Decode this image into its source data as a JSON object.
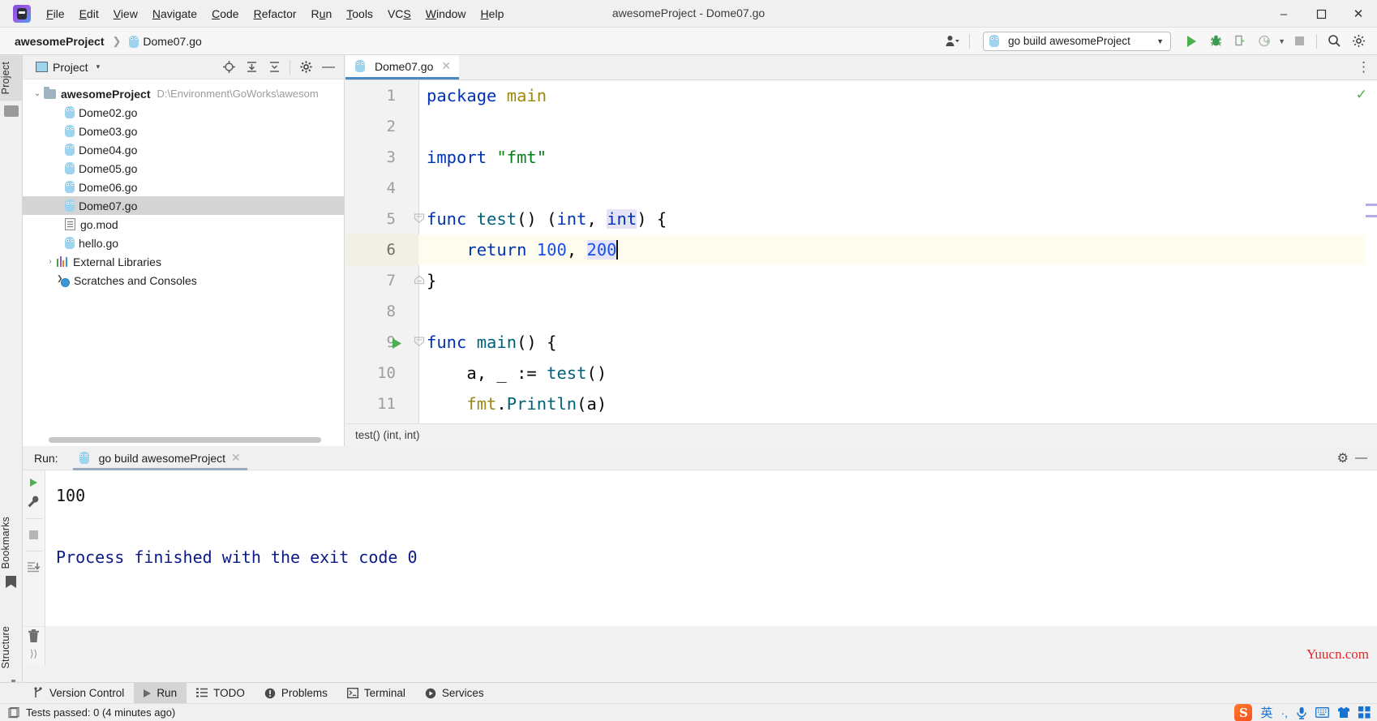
{
  "window": {
    "title": "awesomeProject - Dome07.go",
    "minimize_label": "–",
    "maximize_label": "❐",
    "close_label": "✕"
  },
  "menu": {
    "items": [
      "File",
      "Edit",
      "View",
      "Navigate",
      "Code",
      "Refactor",
      "Run",
      "Tools",
      "VCS",
      "Window",
      "Help"
    ]
  },
  "navbar": {
    "breadcrumb": {
      "project": "awesomeProject",
      "separator": "❯",
      "file": "Dome07.go"
    },
    "run_config": "go build awesomeProject",
    "run_config_caret": "▼",
    "user_caret": "▾",
    "search_icon": "⚲",
    "settings_icon": "⚙",
    "more_icon": "⋮"
  },
  "left_strip": {
    "project_tab": "Project",
    "bookmarks_tab": "Bookmarks",
    "structure_tab": "Structure"
  },
  "project_pane": {
    "title": "Project",
    "title_caret": "▾",
    "action_icons": [
      "locate-icon",
      "expand-all-icon",
      "collapse-all-icon",
      "settings-icon",
      "hide-icon"
    ],
    "root": {
      "label": "awesomeProject",
      "path": "D:\\Environment\\GoWorks\\awesom",
      "chevron": "⌄"
    },
    "children": [
      {
        "label": "Dome02.go",
        "icon": "go-file-icon",
        "selected": false
      },
      {
        "label": "Dome03.go",
        "icon": "go-file-icon",
        "selected": false
      },
      {
        "label": "Dome04.go",
        "icon": "go-file-icon",
        "selected": false
      },
      {
        "label": "Dome05.go",
        "icon": "go-file-icon",
        "selected": false
      },
      {
        "label": "Dome06.go",
        "icon": "go-file-icon",
        "selected": false
      },
      {
        "label": "Dome07.go",
        "icon": "go-file-icon",
        "selected": true
      },
      {
        "label": "go.mod",
        "icon": "mod-file-icon",
        "selected": false
      },
      {
        "label": "hello.go",
        "icon": "go-file-icon",
        "selected": false
      }
    ],
    "external_libraries": {
      "label": "External Libraries",
      "chevron": "›"
    },
    "scratches": {
      "label": "Scratches and Consoles"
    }
  },
  "editor": {
    "tab": {
      "label": "Dome07.go",
      "close": "✕"
    },
    "breadcrumb": "test() (int, int)",
    "inspection_ok_icon": "✓",
    "lines": [
      {
        "n": "1",
        "tokens": [
          {
            "t": "package",
            "c": "kw"
          },
          {
            "t": " ",
            "c": "pl"
          },
          {
            "t": "main",
            "c": "pkg"
          }
        ]
      },
      {
        "n": "2",
        "tokens": []
      },
      {
        "n": "3",
        "tokens": [
          {
            "t": "import",
            "c": "kw"
          },
          {
            "t": " ",
            "c": "pl"
          },
          {
            "t": "\"fmt\"",
            "c": "str"
          }
        ]
      },
      {
        "n": "4",
        "tokens": []
      },
      {
        "n": "5",
        "fold": true,
        "tokens": [
          {
            "t": "func",
            "c": "kw"
          },
          {
            "t": " ",
            "c": "pl"
          },
          {
            "t": "test",
            "c": "fn"
          },
          {
            "t": "() (",
            "c": "pl"
          },
          {
            "t": "int",
            "c": "kw"
          },
          {
            "t": ", ",
            "c": "pl"
          },
          {
            "t": "int",
            "c": "kw hlid"
          },
          {
            "t": ") {",
            "c": "pl"
          }
        ]
      },
      {
        "n": "6",
        "highlight": true,
        "caret": true,
        "tokens": [
          {
            "t": "    ",
            "c": "pl"
          },
          {
            "t": "return",
            "c": "kw"
          },
          {
            "t": " ",
            "c": "pl"
          },
          {
            "t": "100",
            "c": "num"
          },
          {
            "t": ", ",
            "c": "pl"
          },
          {
            "t": "200",
            "c": "num hlid"
          }
        ]
      },
      {
        "n": "7",
        "foldEnd": true,
        "tokens": [
          {
            "t": "}",
            "c": "pl"
          }
        ]
      },
      {
        "n": "8",
        "tokens": []
      },
      {
        "n": "9",
        "fold": true,
        "gutterRun": true,
        "tokens": [
          {
            "t": "func",
            "c": "kw"
          },
          {
            "t": " ",
            "c": "pl"
          },
          {
            "t": "main",
            "c": "fn"
          },
          {
            "t": "() {",
            "c": "pl"
          }
        ]
      },
      {
        "n": "10",
        "tokens": [
          {
            "t": "    a, _ ",
            "c": "pl"
          },
          {
            "t": ":=",
            "c": "pl"
          },
          {
            "t": " ",
            "c": "pl"
          },
          {
            "t": "test",
            "c": "fn"
          },
          {
            "t": "()",
            "c": "pl"
          }
        ]
      },
      {
        "n": "11",
        "tokens": [
          {
            "t": "    ",
            "c": "pl"
          },
          {
            "t": "fmt",
            "c": "pkg"
          },
          {
            "t": ".",
            "c": "pl"
          },
          {
            "t": "Println",
            "c": "fn"
          },
          {
            "t": "(a)",
            "c": "pl"
          }
        ]
      }
    ]
  },
  "run_panel": {
    "label": "Run:",
    "tab_label": "go build awesomeProject",
    "tab_close": "✕",
    "settings_icon": "⚙",
    "hide_icon": "—",
    "side_icons": [
      "rerun-icon",
      "wrench-icon",
      "stop-icon",
      "scroll-to-end-icon",
      "trash-icon",
      "more-icon"
    ],
    "more_label": "⟩⟩",
    "console_lines": [
      "100",
      "",
      "Process finished with the exit code 0"
    ]
  },
  "bottom_bar": {
    "items": [
      {
        "label": "Version Control",
        "icon": "branch-icon",
        "active": false
      },
      {
        "label": "Run",
        "icon": "play-icon",
        "active": true
      },
      {
        "label": "TODO",
        "icon": "list-icon",
        "active": false
      },
      {
        "label": "Problems",
        "icon": "warning-icon",
        "active": false
      },
      {
        "label": "Terminal",
        "icon": "terminal-icon",
        "active": false
      },
      {
        "label": "Services",
        "icon": "services-icon",
        "active": false
      }
    ]
  },
  "status_bar": {
    "message": "Tests passed: 0 (4 minutes ago)",
    "tray": [
      "sogou-icon",
      "英",
      "·,",
      "mic-icon",
      "keyboard-icon",
      "skin-icon",
      "apps-icon"
    ]
  },
  "watermark": "Yuucn.com",
  "colors": {
    "accent": "#4a87c8",
    "keyword": "#0033b3",
    "function": "#00627a",
    "string": "#067d17",
    "number": "#1750eb",
    "package": "#9e880d",
    "identifier_highlight": "#e6e3f7",
    "caret_line": "#fdfcee",
    "run_green": "#4caf50",
    "watermark": "#e8262a"
  }
}
